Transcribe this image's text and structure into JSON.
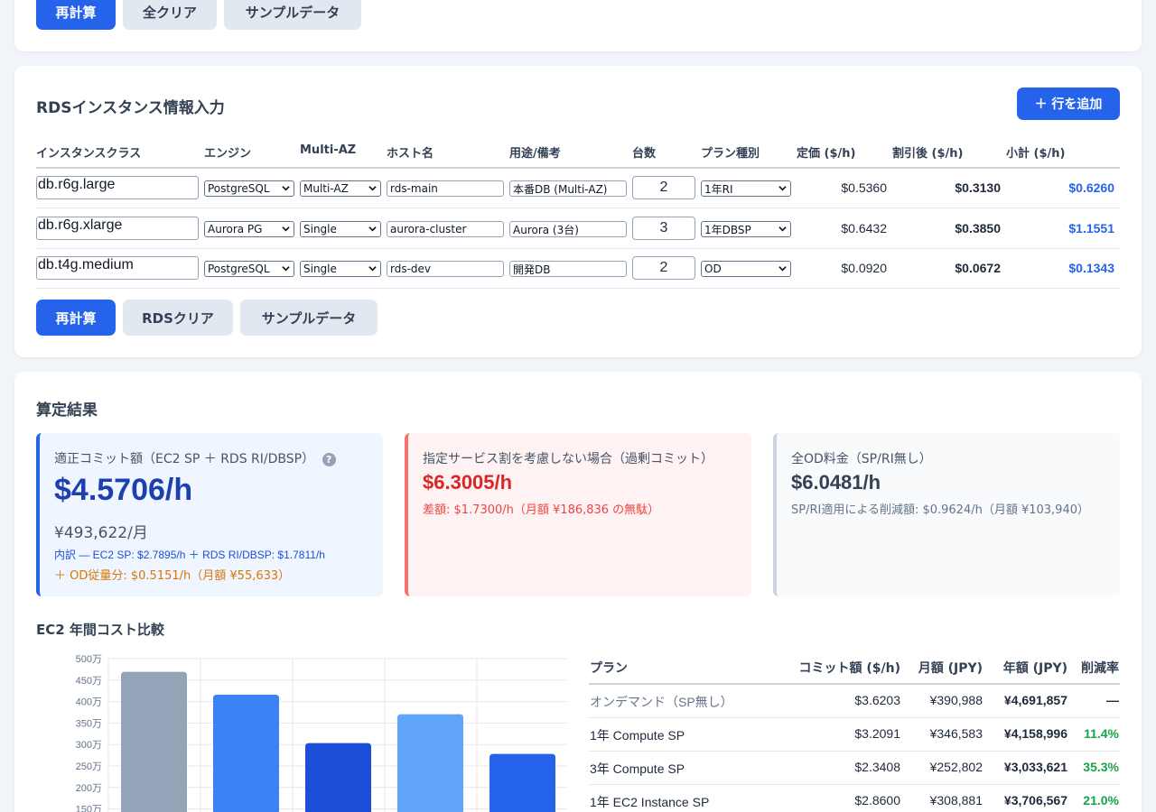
{
  "top_buttons": {
    "recalc": "再計算",
    "clear_all": "全クリア",
    "sample": "サンプルデータ"
  },
  "rds": {
    "title": "RDSインスタンス情報入力",
    "add_row": "＋ 行を追加",
    "headers": [
      "インスタンスクラス",
      "エンジン",
      "Multi-AZ",
      "ホスト名",
      "用途/備考",
      "台数",
      "プラン種別",
      "定価 ($/h)",
      "割引後 ($/h)",
      "小計 ($/h)"
    ],
    "rows": [
      {
        "instance_class": "db.r6g.large",
        "engine": "PostgreSQL",
        "multi_az": "Multi-AZ",
        "host": "rds-main",
        "note": "本番DB (Multi-AZ)",
        "count": "2",
        "plan": "1年RI",
        "list_price": "$0.5360",
        "discounted": "$0.3130",
        "subtotal": "$0.6260"
      },
      {
        "instance_class": "db.r6g.xlarge",
        "engine": "Aurora PG",
        "multi_az": "Single",
        "host": "aurora-cluster",
        "note": "Aurora (3台)",
        "count": "3",
        "plan": "1年DBSP",
        "list_price": "$0.6432",
        "discounted": "$0.3850",
        "subtotal": "$1.1551"
      },
      {
        "instance_class": "db.t4g.medium",
        "engine": "PostgreSQL",
        "multi_az": "Single",
        "host": "rds-dev",
        "note": "開発DB",
        "count": "2",
        "plan": "OD",
        "list_price": "$0.0920",
        "discounted": "$0.0672",
        "subtotal": "$0.1343"
      }
    ],
    "buttons": {
      "recalc": "再計算",
      "clear": "RDSクリア",
      "sample": "サンプルデータ"
    }
  },
  "results": {
    "title": "算定結果",
    "optimal": {
      "label": "適正コミット額（EC2 SP ＋ RDS RI/DBSP）",
      "help": "?",
      "hourly": "$4.5706/h",
      "monthly": "¥493,622/月",
      "breakdown": "内訳 — EC2 SP: $2.7895/h ＋ RDS RI/DBSP: $1.7811/h",
      "od_part": "＋ OD従量分: $0.5151/h（月額 ¥55,633）"
    },
    "over": {
      "label": "指定サービス割を考慮しない場合（過剰コミット）",
      "hourly": "$6.3005/h",
      "diff": "差額: $1.7300/h（月額 ¥186,836 の無駄）"
    },
    "od": {
      "label": "全OD料金（SP/RI無し）",
      "hourly": "$6.0481/h",
      "savings": "SP/RI適用による削減額: $0.9624/h（月額 ¥103,940）"
    },
    "ec2_title": "EC2 年間コスト比較"
  },
  "colors": {
    "accent": "#2563eb",
    "bar_od": "#94a3b8",
    "bar_1y_compute": "#3b82f6",
    "bar_3y_compute": "#1d4ed8",
    "bar_1y_ec2": "#60a5fa",
    "bar_5": "#2563eb"
  },
  "chart_data": {
    "type": "bar",
    "y_tick_labels": [
      "500万",
      "450万",
      "400万",
      "350万",
      "300万",
      "250万",
      "200万",
      "150万"
    ],
    "ylim": [
      0,
      5000000
    ],
    "grid": true,
    "values": [
      4691857,
      4158996,
      3033621,
      3706567,
      2780000
    ]
  },
  "comparison_table": {
    "headers": [
      "プラン",
      "コミット額 ($/h)",
      "月額 (JPY)",
      "年額 (JPY)",
      "削減率"
    ],
    "rows": [
      {
        "plan": "オンデマンド（SP無し）",
        "commit": "$3.6203",
        "monthly": "¥390,988",
        "annual": "¥4,691,857",
        "rate": "—"
      },
      {
        "plan": "1年 Compute SP",
        "commit": "$3.2091",
        "monthly": "¥346,583",
        "annual": "¥4,158,996",
        "rate": "11.4%"
      },
      {
        "plan": "3年 Compute SP",
        "commit": "$2.3408",
        "monthly": "¥252,802",
        "annual": "¥3,033,621",
        "rate": "35.3%"
      },
      {
        "plan": "1年 EC2 Instance SP",
        "commit": "$2.8600",
        "monthly": "¥308,881",
        "annual": "¥3,706,567",
        "rate": "21.0%"
      }
    ]
  }
}
